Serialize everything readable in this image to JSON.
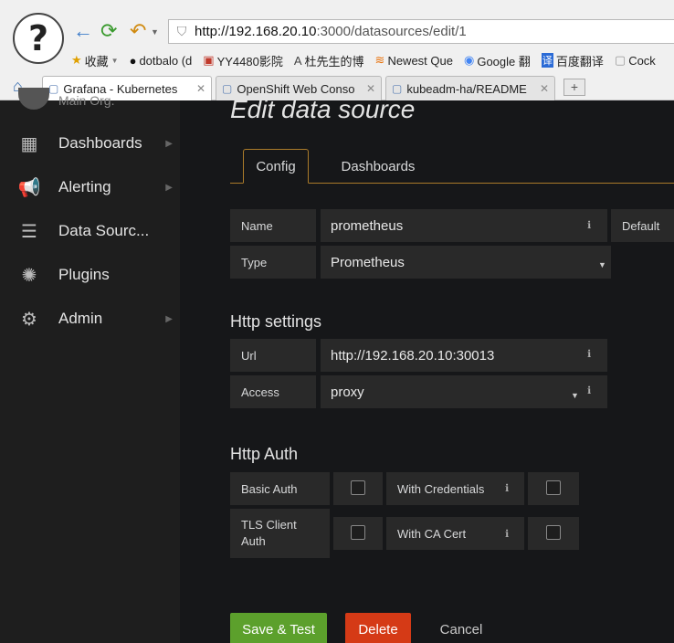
{
  "browser": {
    "logo_glyph": "?",
    "back_icon": "←",
    "refresh_icon": "⟳",
    "undo_icon": "↶",
    "address": {
      "host": "http://192.168.20.10",
      "path": ":3000/datasources/edit/1"
    },
    "bookmarks": [
      {
        "icon": "★",
        "label": "收藏"
      },
      {
        "icon": "●",
        "label": "dotbalo (d"
      },
      {
        "icon": "▣",
        "label": "YY4480影院"
      },
      {
        "icon": "A",
        "label": "杜先生的博"
      },
      {
        "icon": "≋",
        "label": "Newest Que"
      },
      {
        "icon": "◉",
        "label": "Google 翻"
      },
      {
        "icon": "译",
        "label": "百度翻译"
      },
      {
        "icon": "▢",
        "label": "Cock"
      }
    ],
    "tabs": [
      {
        "label": "Grafana - Kubernetes"
      },
      {
        "label": "OpenShift Web Conso"
      },
      {
        "label": "kubeadm-ha/README"
      }
    ],
    "new_tab": "+"
  },
  "sidebar": {
    "org": "Main Org.",
    "items": [
      {
        "label": "Dashboards",
        "icon": "▦"
      },
      {
        "label": "Alerting",
        "icon": "📢"
      },
      {
        "label": "Data Sourc...",
        "icon": "☰"
      },
      {
        "label": "Plugins",
        "icon": "✺"
      },
      {
        "label": "Admin",
        "icon": "⚙"
      }
    ]
  },
  "main": {
    "title": "Edit data source",
    "tabs": [
      "Config",
      "Dashboards"
    ],
    "form": {
      "name_label": "Name",
      "name_value": "prometheus",
      "default_label": "Default",
      "type_label": "Type",
      "type_value": "Prometheus"
    },
    "http": {
      "section": "Http settings",
      "url_label": "Url",
      "url_value": "http://192.168.20.10:30013",
      "access_label": "Access",
      "access_value": "proxy"
    },
    "auth": {
      "section": "Http Auth",
      "basic_auth": "Basic Auth",
      "with_credentials": "With Credentials",
      "tls_client_auth": "TLS Client Auth",
      "with_ca_cert": "With CA Cert"
    },
    "buttons": {
      "save": "Save & Test",
      "delete": "Delete",
      "cancel": "Cancel"
    }
  }
}
